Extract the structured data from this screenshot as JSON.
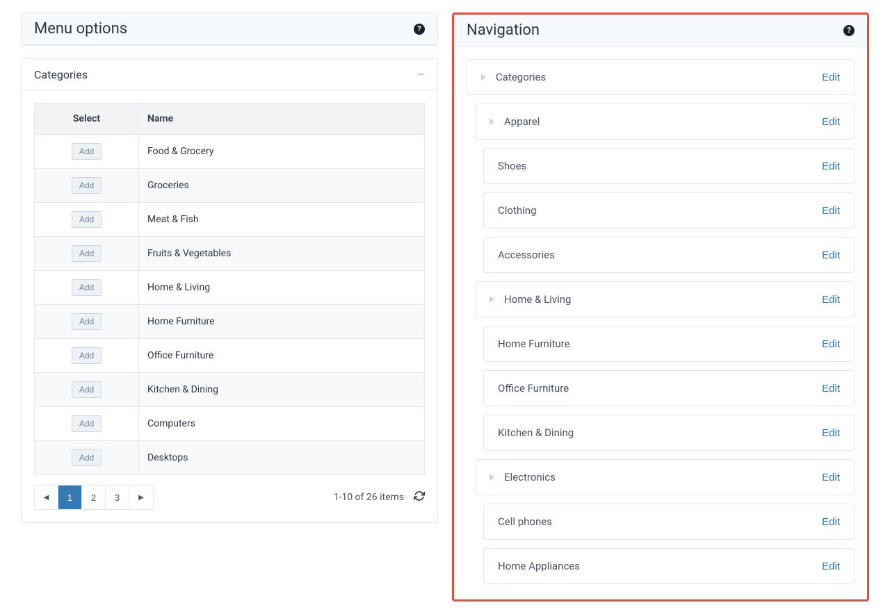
{
  "left": {
    "title": "Menu options",
    "sub_title": "Categories",
    "table": {
      "col_select": "Select",
      "col_name": "Name",
      "add_label": "Add",
      "rows": [
        "Food & Grocery",
        "Groceries",
        "Meat & Fish",
        "Fruits & Vegetables",
        "Home & Living",
        "Home Furniture",
        "Office Furniture",
        "Kitchen & Dining",
        "Computers",
        "Desktops"
      ]
    },
    "pager": {
      "pages": [
        "1",
        "2",
        "3"
      ],
      "status": "1-10 of 26 items"
    }
  },
  "right": {
    "title": "Navigation",
    "edit": "Edit",
    "items": [
      {
        "label": "Categories",
        "indent": 0,
        "tri": true
      },
      {
        "label": "Apparel",
        "indent": 1,
        "tri": true
      },
      {
        "label": "Shoes",
        "indent": 2,
        "tri": false
      },
      {
        "label": "Clothing",
        "indent": 2,
        "tri": false
      },
      {
        "label": "Accessories",
        "indent": 2,
        "tri": false
      },
      {
        "label": "Home & Living",
        "indent": 1,
        "tri": true
      },
      {
        "label": "Home Furniture",
        "indent": 2,
        "tri": false
      },
      {
        "label": "Office Furniture",
        "indent": 2,
        "tri": false
      },
      {
        "label": "Kitchen & Dining",
        "indent": 2,
        "tri": false
      },
      {
        "label": "Electronics",
        "indent": 1,
        "tri": true
      },
      {
        "label": "Cell phones",
        "indent": 2,
        "tri": false
      },
      {
        "label": "Home Appliances",
        "indent": 2,
        "tri": false
      }
    ]
  }
}
